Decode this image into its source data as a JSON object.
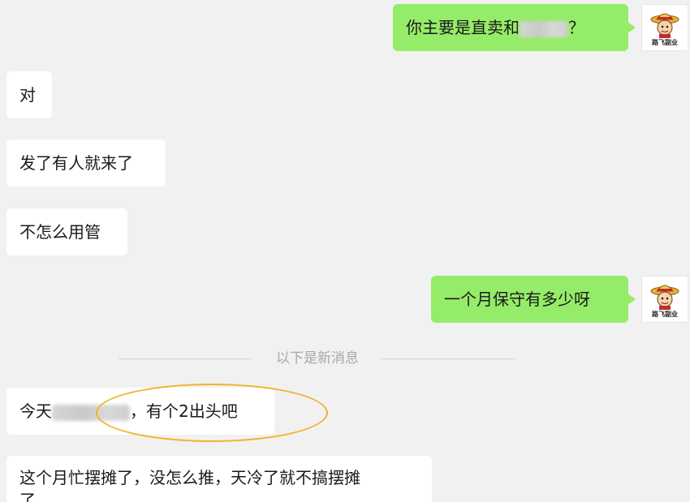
{
  "messages": [
    {
      "side": "out",
      "text_before": "你主要是直卖和",
      "text_after": "？"
    },
    {
      "side": "in",
      "text": "对"
    },
    {
      "side": "in",
      "text": "发了有人就来了"
    },
    {
      "side": "in",
      "text": "不怎么用管"
    },
    {
      "side": "out",
      "text": "一个月保守有多少呀"
    },
    {
      "side": "in",
      "text_before": "今天",
      "text_after": "，有个2出头吧"
    },
    {
      "side": "in",
      "line1": "这个月忙摆摊了，没怎么推，天冷了就不搞摆摊",
      "line2": "了"
    }
  ],
  "divider": {
    "label": "以下是新消息"
  },
  "avatar": {
    "caption": "路飞副业",
    "icon": "straw-hat-avatar-icon"
  },
  "colors": {
    "background": "#f1f1f1",
    "outgoing_bubble": "#95ec69",
    "incoming_bubble": "#ffffff",
    "highlight_circle": "#f0b429"
  }
}
